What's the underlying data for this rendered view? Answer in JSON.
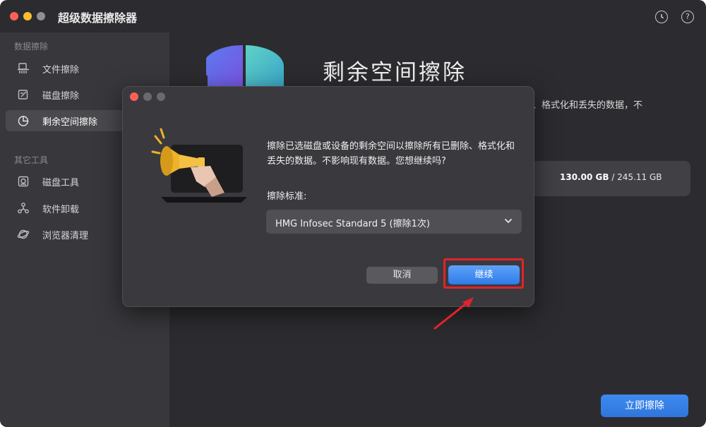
{
  "app": {
    "title": "超级数据擦除器",
    "traffic_colors": [
      "#fe5f57",
      "#febc2e",
      "#8e8e93"
    ],
    "header_icons": [
      "history-icon",
      "help-icon"
    ]
  },
  "sidebar": {
    "section1_title": "数据擦除",
    "items1": [
      {
        "label": "文件擦除",
        "icon": "file-shredder-icon"
      },
      {
        "label": "磁盘擦除",
        "icon": "disk-erase-icon"
      },
      {
        "label": "剩余空间擦除",
        "icon": "pie-chart-icon"
      }
    ],
    "section2_title": "其它工具",
    "items2": [
      {
        "label": "磁盘工具",
        "icon": "disk-tool-icon"
      },
      {
        "label": "软件卸载",
        "icon": "uninstall-icon"
      },
      {
        "label": "浏览器清理",
        "icon": "browser-clean-icon"
      }
    ],
    "active_item": "剩余空间擦除"
  },
  "main": {
    "title": "剩余空间擦除",
    "description_tail": "、格式化和丢失的数据，不",
    "disk_used": "130.00 GB",
    "disk_total": "/ 245.11 GB",
    "erase_button": "立即擦除"
  },
  "dialog": {
    "message": "擦除已选磁盘或设备的剩余空间以擦除所有已删除、格式化和丢失的数据。不影响现有数据。您想继续吗?",
    "standard_label": "擦除标准:",
    "standard_value": "HMG Infosec Standard 5 (擦除1次)",
    "cancel": "取消",
    "continue": "继续",
    "illustration": "megaphone-icon"
  },
  "annotation": {
    "color": "#e0242a"
  }
}
